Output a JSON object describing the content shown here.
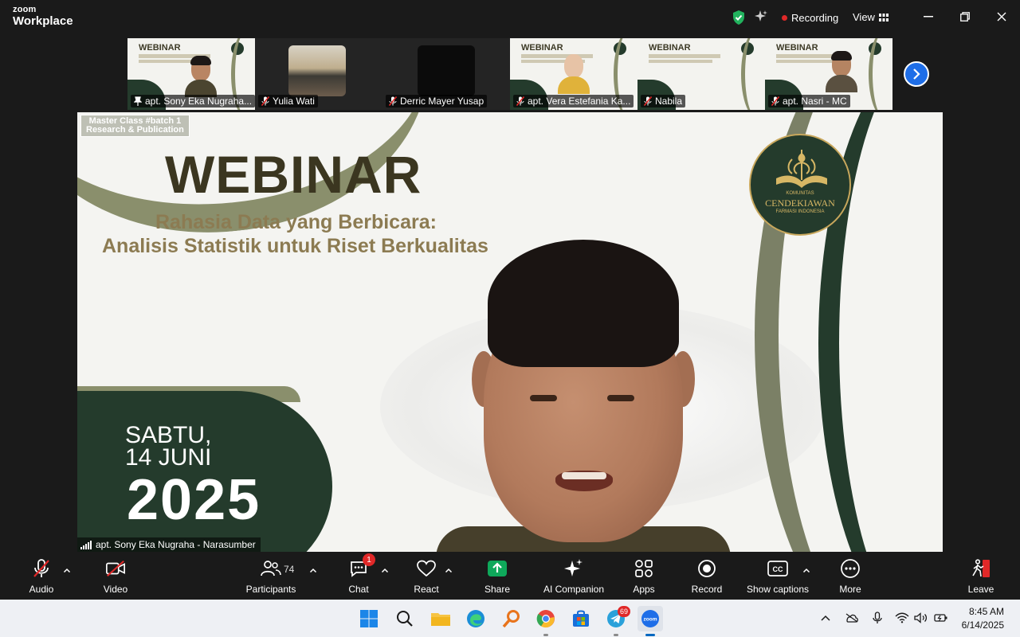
{
  "app": {
    "brand_line1": "zoom",
    "brand_line2": "Workplace"
  },
  "titlebar": {
    "recording_label": "Recording",
    "view_label": "View"
  },
  "thumbnails": [
    {
      "name": "apt. Sony Eka Nugraha...",
      "active": true
    },
    {
      "name": "Yulia Wati",
      "active": false
    },
    {
      "name": "Derric Mayer Yusap",
      "active": false
    },
    {
      "name": "apt. Vera Estefania Ka...",
      "active": false
    },
    {
      "name": "Nabila",
      "active": false
    },
    {
      "name": "apt. Nasri - MC",
      "active": false
    }
  ],
  "slide": {
    "badge_line1": "Master Class #batch 1",
    "badge_line2": "Research & Publication",
    "title": "WEBINAR",
    "subtitle_line1": "Rahasia Data yang Berbicara:",
    "subtitle_line2": "Analisis Statistik untuk Riset Berkualitas",
    "emblem_line1": "KOMUNITAS",
    "emblem_line2": "CENDEKIAWAN",
    "emblem_line3": "FARMASI INDONESIA",
    "day": "SABTU,",
    "date": "14 JUNI",
    "year": "2025"
  },
  "speaker": {
    "name": "apt. Sony Eka Nugraha - Narasumber"
  },
  "toolbar": {
    "audio": "Audio",
    "video": "Video",
    "participants": "Participants",
    "participants_count": "74",
    "chat": "Chat",
    "chat_badge": "1",
    "react": "React",
    "share": "Share",
    "ai_companion": "AI Companion",
    "apps": "Apps",
    "record": "Record",
    "captions": "Show captions",
    "more": "More",
    "leave": "Leave"
  },
  "taskbar": {
    "time": "8:45 AM",
    "date": "6/14/2025",
    "telegram_badge": "69"
  },
  "colors": {
    "accent_green": "#2ecc71",
    "brand_dark_green": "#243b2c",
    "share_green": "#0ea85a",
    "recording_red": "#e02828",
    "zoom_blue": "#1e6ee8"
  }
}
